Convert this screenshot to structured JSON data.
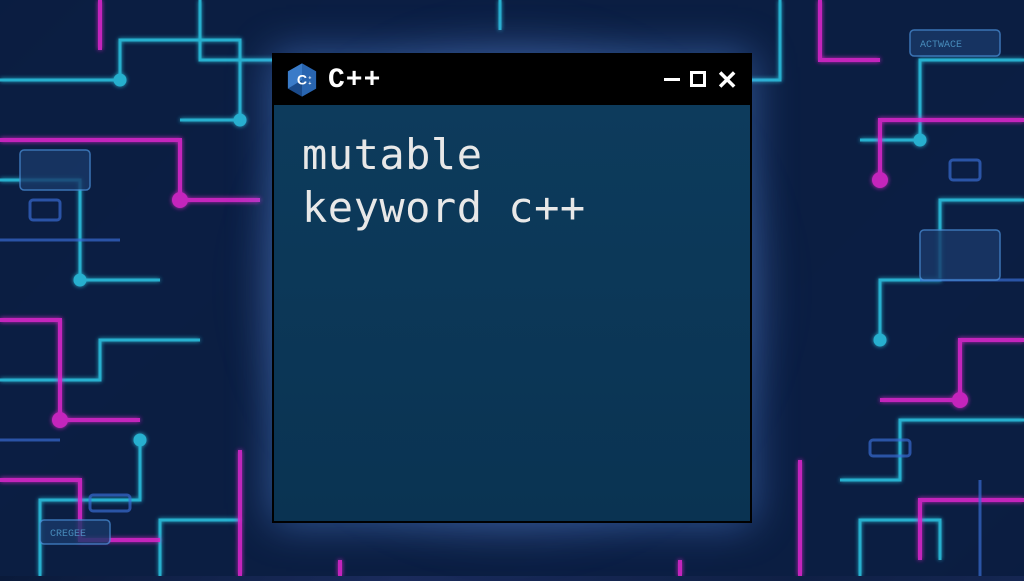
{
  "window": {
    "title": "C++",
    "body_line1": "mutable",
    "body_line2": "keyword c++"
  },
  "colors": {
    "window_bg": "#0d3b5c",
    "titlebar_bg": "#000000",
    "text": "#e8e8e8",
    "logo_primary": "#2965b0",
    "logo_secondary": "#1a4a8a"
  },
  "icons": {
    "logo": "cpp-hexagon-logo",
    "minimize": "minimize-icon",
    "maximize": "maximize-icon",
    "close": "close-icon"
  }
}
